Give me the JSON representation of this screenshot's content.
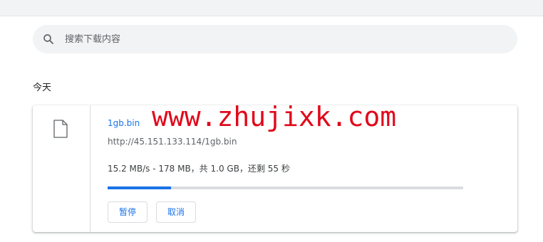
{
  "search": {
    "placeholder": "搜索下载内容",
    "icon": "search-icon"
  },
  "section": {
    "date_heading": "今天"
  },
  "download": {
    "filename": "1gb.bin",
    "url": "http://45.151.133.114/1gb.bin",
    "status": "15.2 MB/s - 178 MB，共 1.0 GB，还剩 55 秒",
    "progress_fraction": 0.178,
    "file_icon": "file-icon",
    "pause_label": "暂停",
    "cancel_label": "取消"
  },
  "watermark": {
    "text": "www.zhujixk.com"
  },
  "colors": {
    "accent": "#1a73e8",
    "watermark": "#e0091b",
    "track": "#dadce0"
  }
}
